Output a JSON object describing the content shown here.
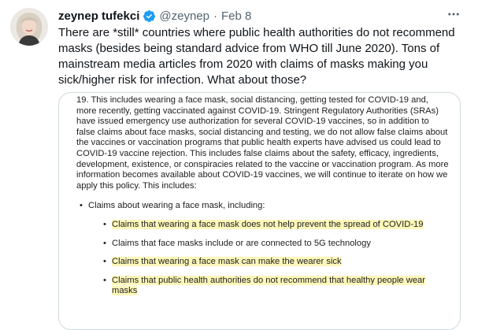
{
  "author": {
    "name": "zeynep tufekci",
    "handle": "@zeynep",
    "separator": "·",
    "date": "Feb 8",
    "verified": true,
    "avatar_icon": "user-avatar"
  },
  "menu_icon": "more-horizontal-icon",
  "tweet_text": "There are *still* countries where public health authorities do not recommend masks (besides being standard advice from WHO till June 2020). Tons of mainstream media articles from 2020 with claims of masks making you sick/higher risk for infection. What about those?",
  "document": {
    "paragraph": "19. This includes wearing a face mask, social distancing, getting tested for COVID-19 and, more recently, getting vaccinated against COVID-19. Stringent Regulatory Authorities (SRAs) have issued emergency use authorization for several COVID-19 vaccines, so in addition to false claims about face masks, social distancing and testing, we do not allow false claims about the vaccines or vaccination programs that public health experts have advised us could lead to COVID-19 vaccine rejection. This includes false claims about the safety, efficacy, ingredients, development, existence, or conspiracies related to the vaccine or vaccination program. As more information becomes available about COVID-19 vaccines, we will continue to iterate on how we apply this policy. This includes:",
    "bullet": "Claims about wearing a face mask, including:",
    "sub_bullets": [
      {
        "text": "Claims that wearing a face mask does not help prevent the spread of COVID-19",
        "highlighted": true
      },
      {
        "text": "Claims that face masks include or are connected to 5G technology",
        "highlighted": false
      },
      {
        "text": "Claims that wearing a face mask can make the wearer sick",
        "highlighted": true
      },
      {
        "text": "Claims that public health authorities do not recommend that healthy people wear masks",
        "highlighted": true
      }
    ],
    "bullet_glyph": "•"
  },
  "colors": {
    "verified_blue": "#1d9bf0",
    "highlight": "#fdf7b9",
    "secondary_text": "#536471",
    "border": "#cfd9de"
  }
}
